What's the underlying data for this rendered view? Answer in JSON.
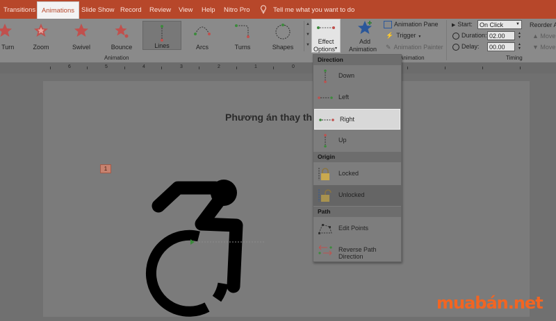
{
  "tabs": [
    "Transitions",
    "Animations",
    "Slide Show",
    "Record",
    "Review",
    "View",
    "Help",
    "Nitro Pro"
  ],
  "tell_me": "Tell me what you want to do",
  "gallery": [
    {
      "label": "& Turn",
      "icon": "star-turn-icon"
    },
    {
      "label": "Zoom",
      "icon": "star-zoom-icon"
    },
    {
      "label": "Swivel",
      "icon": "star-swivel-icon"
    },
    {
      "label": "Bounce",
      "icon": "star-bounce-icon"
    },
    {
      "label": "Lines",
      "icon": "lines-path-icon"
    },
    {
      "label": "Arcs",
      "icon": "arcs-path-icon"
    },
    {
      "label": "Turns",
      "icon": "turns-path-icon"
    },
    {
      "label": "Shapes",
      "icon": "shapes-path-icon"
    }
  ],
  "effect_options": {
    "line1": "Effect",
    "line2": "Options"
  },
  "add_animation": {
    "line1": "Add",
    "line2": "Animation"
  },
  "advanced": {
    "pane": "Animation Pane",
    "trigger": "Trigger",
    "painter": "Animation Painter"
  },
  "timing": {
    "start_label": "Start:",
    "start_value": "On Click",
    "duration_label": "Duration:",
    "duration_value": "02.00",
    "delay_label": "Delay:",
    "delay_value": "00.00"
  },
  "reorder": {
    "title": "Reorder An",
    "earlier": "Move",
    "later": "Move"
  },
  "group_labels": {
    "animation": "Animation",
    "advanced": "Animation",
    "timing": "Timing"
  },
  "ruler_numbers": [
    "6",
    "5",
    "4",
    "3",
    "2",
    "1",
    "0"
  ],
  "slide": {
    "title": "Phương án thay th",
    "anim_badge": "1"
  },
  "menu": {
    "direction_header": "Direction",
    "down": "Down",
    "left": "Left",
    "right": "Right",
    "up": "Up",
    "origin_header": "Origin",
    "locked": "Locked",
    "unlocked": "Unlocked",
    "path_header": "Path",
    "edit_points": "Edit Points",
    "reverse": "Reverse Path Direction"
  },
  "watermark": {
    "text": "muabán.net",
    "color": "#f26522"
  },
  "colors": {
    "accent": "#b7472a",
    "star": "#c0504d"
  }
}
